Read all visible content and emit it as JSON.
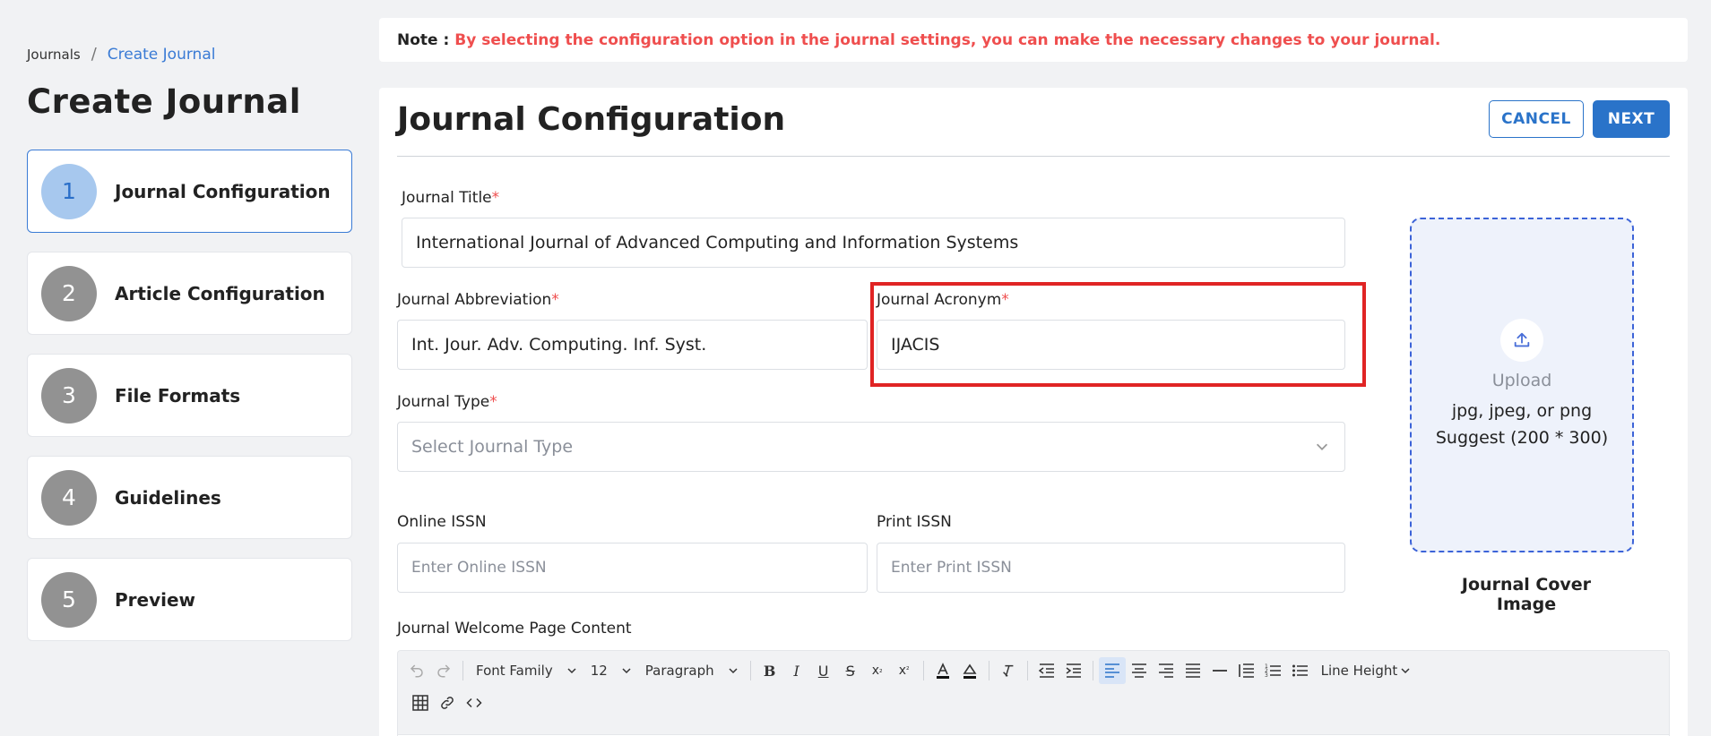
{
  "breadcrumb": {
    "root": "Journals",
    "separator": "/",
    "current": "Create Journal"
  },
  "page_title": "Create Journal",
  "steps": [
    {
      "num": "1",
      "label": "Journal Configuration",
      "active": true
    },
    {
      "num": "2",
      "label": "Article Configuration",
      "active": false
    },
    {
      "num": "3",
      "label": "File Formats",
      "active": false
    },
    {
      "num": "4",
      "label": "Guidelines",
      "active": false
    },
    {
      "num": "5",
      "label": "Preview",
      "active": false
    }
  ],
  "note": {
    "label": "Note :",
    "text": "By selecting the configuration option in the journal settings, you can make the necessary changes to your journal."
  },
  "card": {
    "title": "Journal Configuration",
    "cancel_label": "CANCEL",
    "next_label": "NEXT"
  },
  "form": {
    "journal_title": {
      "label": "Journal Title",
      "required": "*",
      "value": "International Journal of Advanced Computing and Information Systems"
    },
    "journal_abbreviation": {
      "label": "Journal Abbreviation",
      "required": "*",
      "value": "Int. Jour. Adv. Computing. Inf. Syst."
    },
    "journal_acronym": {
      "label": "Journal Acronym",
      "required": "*",
      "value": "IJACIS"
    },
    "journal_type": {
      "label": "Journal Type",
      "required": "*",
      "placeholder": "Select Journal Type"
    },
    "online_issn": {
      "label": "Online ISSN",
      "placeholder": "Enter Online ISSN"
    },
    "print_issn": {
      "label": "Print ISSN",
      "placeholder": "Enter Print ISSN"
    },
    "welcome_content": {
      "label": "Journal Welcome Page Content"
    }
  },
  "upload": {
    "title": "Upload",
    "formats": "jpg, jpeg, or png",
    "suggest": "Suggest (200 * 300)",
    "caption": "Journal Cover Image"
  },
  "toolbar": {
    "font_family": "Font Family",
    "font_size": "12",
    "block_format": "Paragraph",
    "line_height": "Line Height",
    "icons": [
      "undo-icon",
      "redo-icon",
      "bold-icon",
      "italic-icon",
      "underline-icon",
      "strikethrough-icon",
      "subscript-icon",
      "superscript-icon",
      "text-color-icon",
      "highlight-color-icon",
      "clear-format-icon",
      "outdent-icon",
      "indent-icon",
      "align-left-icon",
      "align-center-icon",
      "align-right-icon",
      "align-justify-icon",
      "horizontal-rule-icon",
      "blockquote-icon",
      "numbered-list-icon",
      "bullet-list-icon",
      "table-icon",
      "link-icon",
      "code-icon"
    ]
  },
  "colors": {
    "accent": "#2a73c9",
    "note_red": "#ef4e4e",
    "highlight_red": "#e02424",
    "upload_border": "#3c63d8"
  }
}
